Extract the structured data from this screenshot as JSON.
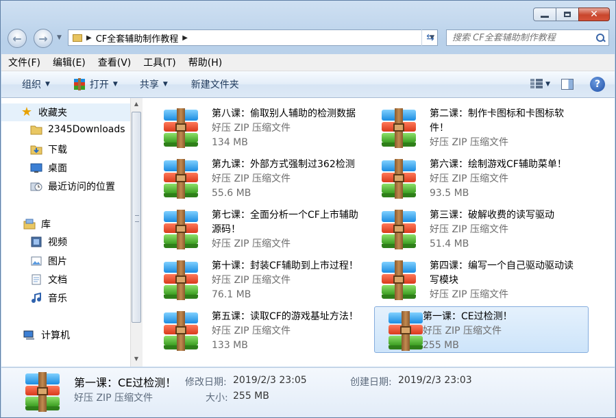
{
  "window": {
    "address_path": "CF全套辅助制作教程",
    "search_placeholder": "搜索 CF全套辅助制作教程"
  },
  "menu": [
    "文件(F)",
    "编辑(E)",
    "查看(V)",
    "工具(T)",
    "帮助(H)"
  ],
  "toolbar": {
    "organize": "组织",
    "open": "打开",
    "share": "共享",
    "new_folder": "新建文件夹"
  },
  "nav": {
    "favorites": "收藏夹",
    "fav_items": [
      "2345Downloads",
      "下载",
      "桌面",
      "最近访问的位置"
    ],
    "libraries": "库",
    "lib_items": [
      "视频",
      "图片",
      "文档",
      "音乐"
    ],
    "computer": "计算机"
  },
  "files": [
    {
      "name": "第八课：偷取别人辅助的检测数据",
      "type": "好压 ZIP 压缩文件",
      "size": "134 MB"
    },
    {
      "name": "第二课：制作卡图标和卡图标软件！",
      "type": "好压 ZIP 压缩文件",
      "size": ""
    },
    {
      "name": "第九课：外部方式强制过362检测",
      "type": "好压 ZIP 压缩文件",
      "size": "55.6 MB"
    },
    {
      "name": "第六课：绘制游戏CF辅助菜单！",
      "type": "好压 ZIP 压缩文件",
      "size": "93.5 MB"
    },
    {
      "name": "第七课：全面分析一个CF上市辅助源码！",
      "type": "好压 ZIP 压缩文件",
      "size": ""
    },
    {
      "name": "第三课：破解收费的读写驱动",
      "type": "好压 ZIP 压缩文件",
      "size": "51.4 MB"
    },
    {
      "name": "第十课：封装CF辅助到上市过程！",
      "type": "好压 ZIP 压缩文件",
      "size": "76.1 MB"
    },
    {
      "name": "第四课：编写一个自己驱动驱动读写模块",
      "type": "好压 ZIP 压缩文件",
      "size": ""
    },
    {
      "name": "第五课：读取CF的游戏基址方法！",
      "type": "好压 ZIP 压缩文件",
      "size": "133 MB"
    },
    {
      "name": "第一课：CE过检测！",
      "type": "好压 ZIP 压缩文件",
      "size": "255 MB"
    }
  ],
  "details": {
    "name": "第一课：CE过检测！",
    "type": "好压 ZIP 压缩文件",
    "modified_label": "修改日期:",
    "modified": "2019/2/3 23:05",
    "created_label": "创建日期:",
    "created": "2019/2/3 23:03",
    "size_label": "大小:",
    "size": "255 MB"
  }
}
